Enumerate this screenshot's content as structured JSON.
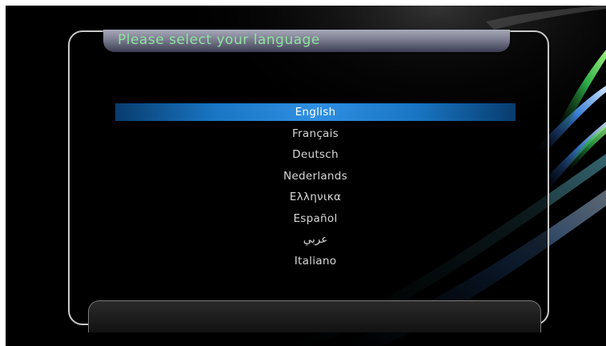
{
  "header": {
    "title": "Please select your language"
  },
  "languages": [
    {
      "label": "English",
      "selected": true
    },
    {
      "label": "Français",
      "selected": false
    },
    {
      "label": "Deutsch",
      "selected": false
    },
    {
      "label": "Nederlands",
      "selected": false
    },
    {
      "label": "Ελληνικα",
      "selected": false
    },
    {
      "label": "Español",
      "selected": false
    },
    {
      "label": "عربي",
      "selected": false
    },
    {
      "label": "Italiano",
      "selected": false
    }
  ],
  "colors": {
    "title_text": "#8ee3a0",
    "selection": "#2f8fe2",
    "panel_border": "#c9c9c9",
    "background": "#000000"
  }
}
